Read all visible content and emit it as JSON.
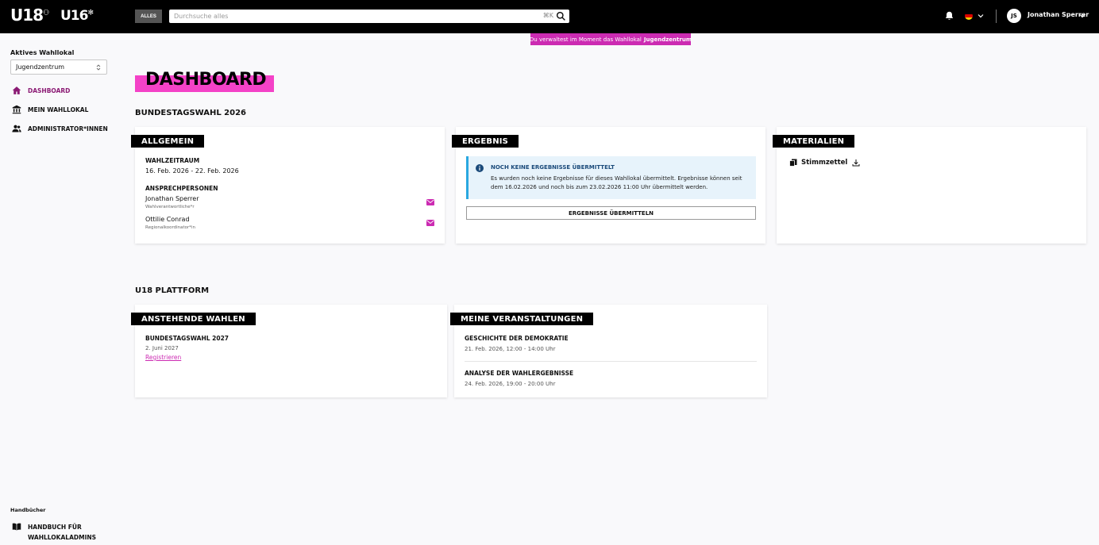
{
  "header": {
    "logo_u18": "U18",
    "logo_u16": "U16",
    "scope_label": "ALLES",
    "search_placeholder": "Durchsuche alles",
    "search_shortcut": "⌘K",
    "user_initials": "JS",
    "user_name": "Jonathan Sperrer"
  },
  "banner": {
    "text": "Du verwaltest im Moment das Wahllokal",
    "location": "Jugendzentrum"
  },
  "sidebar": {
    "active_label": "Aktives Wahllokal",
    "active_value": "Jugendzentrum",
    "items": [
      {
        "label": "DASHBOARD",
        "active": true
      },
      {
        "label": "MEIN WAHLLOKAL",
        "active": false
      },
      {
        "label": "ADMINISTRATOR*INNEN",
        "active": false
      }
    ],
    "handbooks_label": "Handbücher",
    "handbook_item": "HANDBUCH FÜR WAHLLOKALADMINS"
  },
  "main": {
    "title": "DASHBOARD",
    "section_election": "BUNDESTAGSWAHL 2026",
    "allgemein": {
      "tag": "ALLGEMEIN",
      "period_label": "WAHLZEITRAUM",
      "period_value": "16. Feb. 2026 - 22. Feb. 2026",
      "contacts_label": "ANSPRECHPERSONEN",
      "contacts": [
        {
          "name": "Jonathan Sperrer",
          "role": "Wahlverantwortliche*r"
        },
        {
          "name": "Ottilie Conrad",
          "role": "Regionalkoordinator*in"
        }
      ]
    },
    "ergebnis": {
      "tag": "ERGEBNIS",
      "info_title": "NOCH KEINE ERGEBNISSE ÜBERMITTELT",
      "info_text": "Es wurden noch keine Ergebnisse für dieses Wahllokal übermittelt. Ergebnisse können seit dem 16.02.2026 und noch bis zum 23.02.2026 11:00 Uhr übermittelt werden.",
      "button": "ERGEBNISSE ÜBERMITTELN"
    },
    "materialien": {
      "tag": "MATERIALIEN",
      "item": "Stimmzettel"
    },
    "section_platform": "U18 PLATTFORM",
    "anstehend": {
      "tag": "ANSTEHENDE WAHLEN",
      "election_title": "BUNDESTAGSWAHL 2027",
      "election_date": "2. Juni 2027",
      "register_link": "Registrieren"
    },
    "veranstaltungen": {
      "tag": "MEINE VERANSTALTUNGEN",
      "events": [
        {
          "title": "GESCHICHTE DER DEMOKRATIE",
          "time": "21. Feb. 2026, 12:00 - 14:00 Uhr"
        },
        {
          "title": "ANALYSE DER WAHLERGEBNISSE",
          "time": "24. Feb. 2026, 19:00 - 20:00 Uhr"
        }
      ]
    }
  },
  "colors": {
    "accent": "#cc2bb2",
    "title_highlight": "#f442c7",
    "active_nav": "#8b1a74",
    "info_border": "#29a8e0"
  }
}
